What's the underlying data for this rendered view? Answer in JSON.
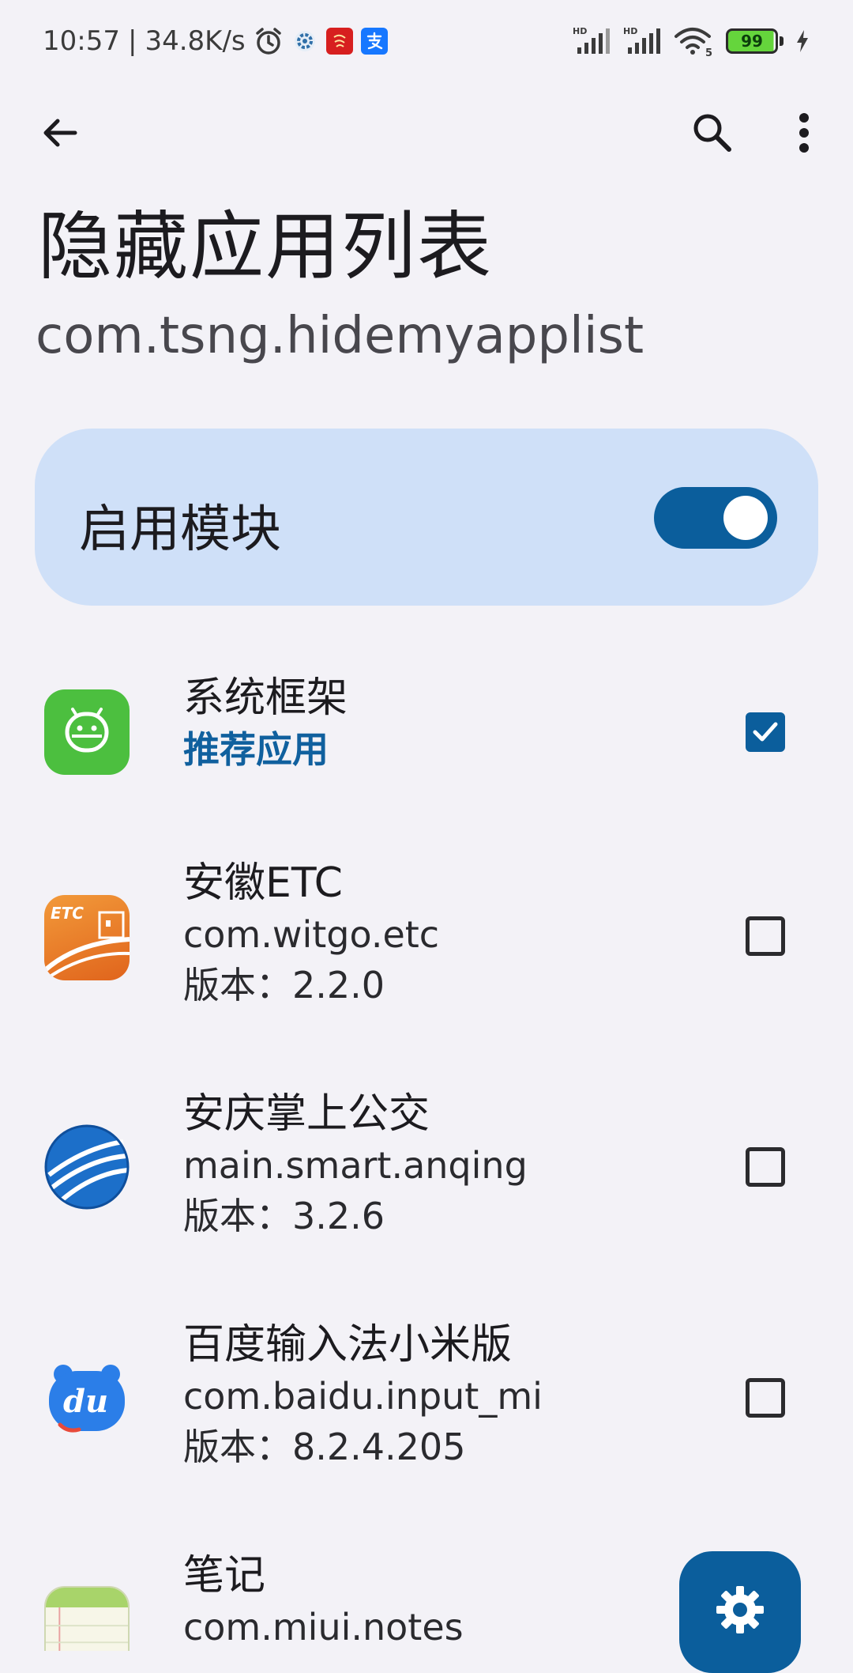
{
  "status_bar": {
    "time": "10:57",
    "separator": "|",
    "net_speed": "34.8K/s",
    "battery": "99",
    "icons": [
      "alarm-icon",
      "settings-gear-icon",
      "red-app-icon",
      "alipay-icon",
      "hd-signal-icon",
      "hd-signal-icon",
      "wifi-icon",
      "battery-icon",
      "charging-icon"
    ],
    "wifi_label": "5"
  },
  "toolbar": {
    "back_icon": "arrow-left-icon",
    "search_icon": "search-icon",
    "more_icon": "more-vertical-icon"
  },
  "header": {
    "title": "隐藏应用列表",
    "subtitle": "com.tsng.hidemyapplist"
  },
  "enable_card": {
    "label": "启用模块",
    "enabled": true
  },
  "apps": [
    {
      "name": "系统框架",
      "secondary": "推荐应用",
      "checked": true,
      "icon": "android-robot-icon",
      "icon_color": "#4cbf3f"
    },
    {
      "name": "安徽ETC",
      "package": "com.witgo.etc",
      "version": "版本：2.2.0",
      "checked": false,
      "icon": "etc-app-icon",
      "icon_color": "#e8792a",
      "icon_text": "ETC"
    },
    {
      "name": "安庆掌上公交",
      "package": "main.smart.anqing",
      "version": "版本：3.2.6",
      "checked": false,
      "icon": "globe-app-icon",
      "icon_color": "#1c6fc9"
    },
    {
      "name": "百度输入法小米版",
      "package": "com.baidu.input_mi",
      "version": "版本：8.2.4.205",
      "checked": false,
      "icon": "baidu-du-icon",
      "icon_color": "#2b7ee8",
      "icon_text": "du"
    },
    {
      "name": "笔记",
      "package": "com.miui.notes",
      "icon": "notes-app-icon",
      "icon_color": "#a8d46a"
    }
  ],
  "fab": {
    "icon": "settings-gear-icon"
  },
  "colors": {
    "background": "#f3f2f7",
    "accent": "#0b5e9c",
    "card": "#cfe0f8"
  }
}
